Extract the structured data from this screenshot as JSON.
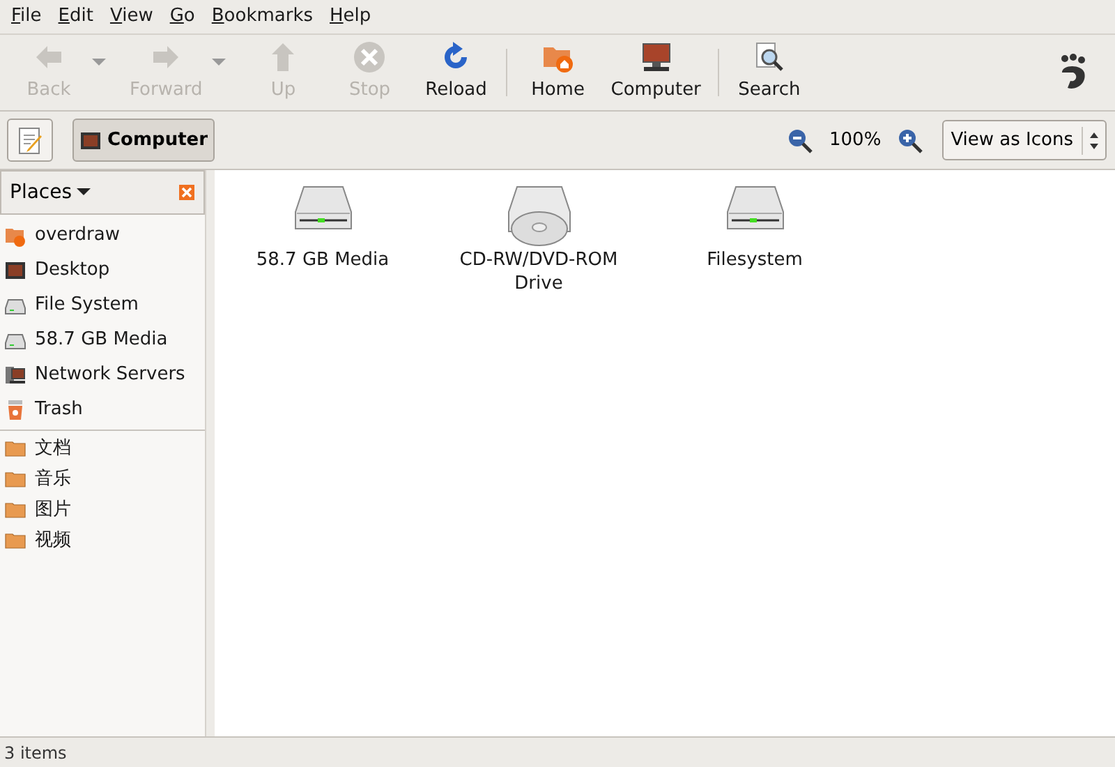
{
  "menu": [
    "File",
    "Edit",
    "View",
    "Go",
    "Bookmarks",
    "Help"
  ],
  "toolbar": [
    {
      "kind": "back",
      "label": "Back",
      "disabled": true,
      "dropdown": true
    },
    {
      "kind": "forward",
      "label": "Forward",
      "disabled": true,
      "dropdown": true
    },
    {
      "kind": "up",
      "label": "Up",
      "disabled": true,
      "dropdown": false
    },
    {
      "kind": "stop",
      "label": "Stop",
      "disabled": true,
      "dropdown": false
    },
    {
      "kind": "reload",
      "label": "Reload",
      "disabled": false,
      "dropdown": false
    },
    {
      "kind": "separator"
    },
    {
      "kind": "home",
      "label": "Home",
      "disabled": false,
      "dropdown": false
    },
    {
      "kind": "computer",
      "label": "Computer",
      "disabled": false,
      "dropdown": false
    },
    {
      "kind": "separator"
    },
    {
      "kind": "search",
      "label": "Search",
      "disabled": false,
      "dropdown": false
    }
  ],
  "location": {
    "path_button": "Computer",
    "zoom": "100%",
    "view_mode": "View as Icons"
  },
  "sidebar": {
    "title": "Places",
    "places": [
      {
        "kind": "home",
        "label": "overdraw"
      },
      {
        "kind": "desktop",
        "label": "Desktop"
      },
      {
        "kind": "drive",
        "label": "File System"
      },
      {
        "kind": "drive",
        "label": "58.7 GB Media"
      },
      {
        "kind": "network",
        "label": "Network Servers"
      },
      {
        "kind": "trash",
        "label": "Trash"
      }
    ],
    "bookmarks": [
      {
        "kind": "folder",
        "label": "文档"
      },
      {
        "kind": "folder",
        "label": "音乐"
      },
      {
        "kind": "folder",
        "label": "图片"
      },
      {
        "kind": "folder",
        "label": "视频"
      }
    ]
  },
  "files": [
    {
      "kind": "drive",
      "label": "58.7 GB Media"
    },
    {
      "kind": "optical",
      "label": "CD-RW/DVD-ROM Drive"
    },
    {
      "kind": "drive",
      "label": "Filesystem"
    }
  ],
  "status_bar": "3 items"
}
